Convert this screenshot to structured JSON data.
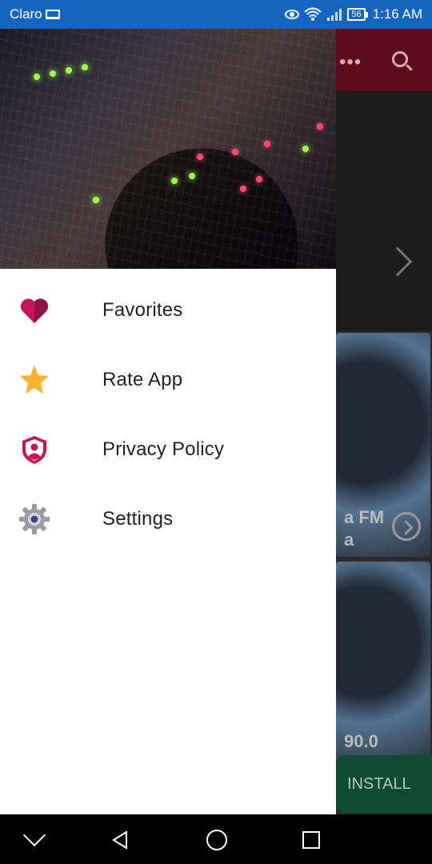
{
  "status_bar": {
    "carrier": "Claro",
    "battery_level": "56",
    "time": "1:16 AM",
    "icons": [
      "laptop-icon",
      "eye-icon",
      "wifi-icon",
      "signal-icon",
      "battery-icon"
    ]
  },
  "background_app": {
    "toolbar_color": "#5e0c1c",
    "card1_text_line1": "a FM",
    "card1_text_line2": "a",
    "card2_text": "90.0",
    "install_label": "INSTALL"
  },
  "drawer": {
    "header_image": "audio-mixing-console",
    "items": [
      {
        "label": "Favorites",
        "icon": "heart-icon"
      },
      {
        "label": "Rate App",
        "icon": "star-icon"
      },
      {
        "label": "Privacy Policy",
        "icon": "shield-icon"
      },
      {
        "label": "Settings",
        "icon": "gear-icon"
      }
    ]
  },
  "colors": {
    "status_bar": "#1565c0",
    "heart": "#c2185b",
    "star": "#f9b233",
    "shield": "#c2185b",
    "gear": "#7a7a85"
  },
  "nav_bar": {
    "icons": [
      "chevron-down-icon",
      "back-icon",
      "home-icon",
      "recent-apps-icon"
    ]
  }
}
